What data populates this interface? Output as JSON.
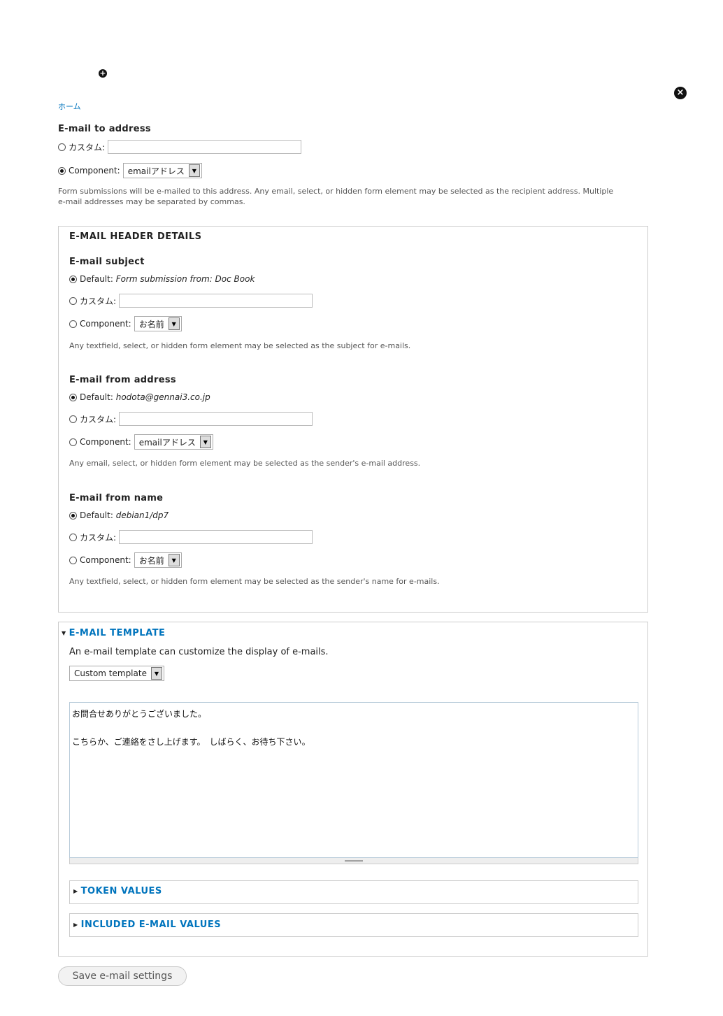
{
  "breadcrumb": {
    "home": "ホーム"
  },
  "to_address": {
    "label": "E-mail to address",
    "custom_label": "カスタム:",
    "component_label": "Component:",
    "component_value": "emailアドレス",
    "description_line1": "Form submissions will be e-mailed to this address. Any email, select, or hidden form element may be selected as the recipient address. Multiple",
    "description_line2": "e-mail addresses may be separated by commas."
  },
  "header_details": {
    "legend": "E-MAIL HEADER DETAILS",
    "subject": {
      "label": "E-mail subject",
      "default_label": "Default:",
      "default_value": "Form submission from: Doc Book",
      "custom_label": "カスタム:",
      "component_label": "Component:",
      "component_value": "お名前",
      "description": "Any textfield, select, or hidden form element may be selected as the subject for e-mails."
    },
    "from_address": {
      "label": "E-mail from address",
      "default_label": "Default:",
      "default_value": "hodota@gennai3.co.jp",
      "custom_label": "カスタム:",
      "component_label": "Component:",
      "component_value": "emailアドレス",
      "description": "Any email, select, or hidden form element may be selected as the sender's e-mail address."
    },
    "from_name": {
      "label": "E-mail from name",
      "default_label": "Default:",
      "default_value": "debian1/dp7",
      "custom_label": "カスタム:",
      "component_label": "Component:",
      "component_value": "お名前",
      "description": "Any textfield, select, or hidden form element may be selected as the sender's name for e-mails."
    }
  },
  "template": {
    "legend": "E-MAIL TEMPLATE",
    "intro": "An e-mail template can customize the display of e-mails.",
    "select_value": "Custom template",
    "body": "お問合せありがとうございました。\n\nこちらか、ご連絡をさし上げます。　しばらく、お待ち下さい。",
    "token_values": "TOKEN VALUES",
    "included_values": "INCLUDED E-MAIL VALUES"
  },
  "save_label": "Save e-mail settings"
}
